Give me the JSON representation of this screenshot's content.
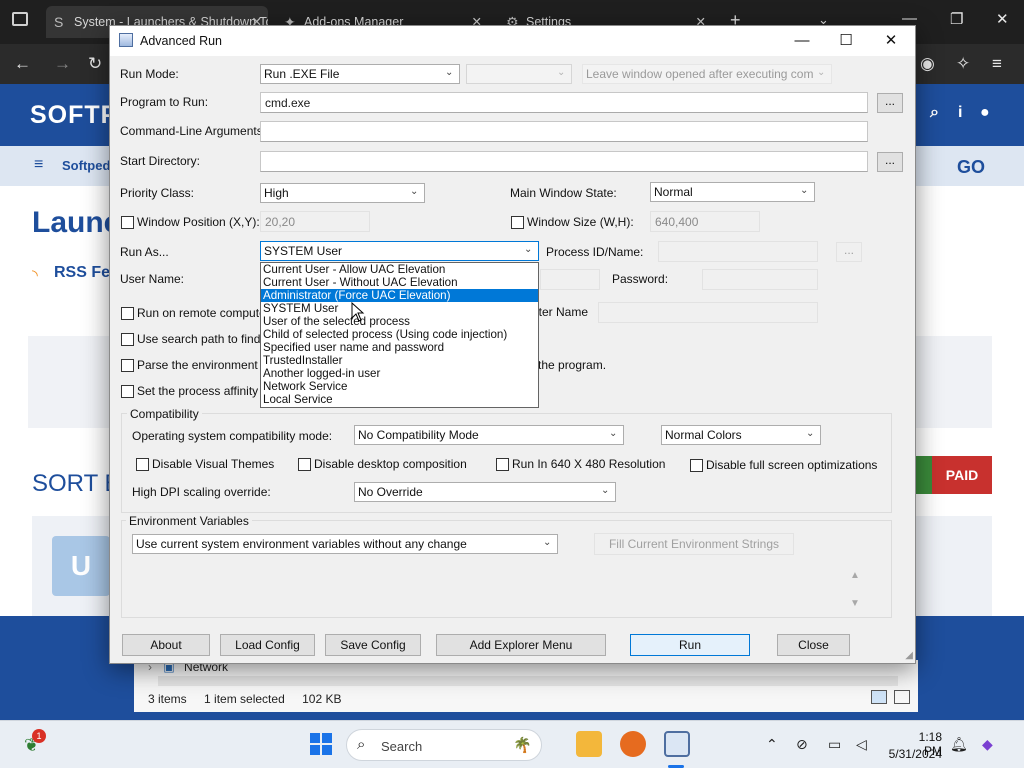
{
  "browser": {
    "tabs": [
      {
        "title": "System - Launchers & Shutdown Tools"
      },
      {
        "title": "Add-ons Manager"
      },
      {
        "title": "Settings"
      }
    ]
  },
  "website": {
    "logo": "SOFTP",
    "nav_label": "Softpedia",
    "go_label": "GO",
    "heading": "Launch",
    "rss_label": "RSS Feed",
    "sort_label": "SORT BY",
    "paid_label": "PAID",
    "thumb_letter": "U"
  },
  "explorer": {
    "network_label": "Network",
    "status": {
      "items": "3 items",
      "selected": "1 item selected",
      "size": "102 KB"
    }
  },
  "taskbar": {
    "notification_count": "1",
    "search_placeholder": "Search",
    "clock_time": "1:18 PM",
    "clock_date": "5/31/2024"
  },
  "dialog": {
    "title": "Advanced Run",
    "run_mode": {
      "label": "Run Mode:",
      "value": "Run .EXE File",
      "leave_open": "Leave window opened after executing command"
    },
    "program": {
      "label": "Program to Run:",
      "value": "cmd.exe",
      "browse": "..."
    },
    "cmdline": {
      "label": "Command-Line Arguments:",
      "value": ""
    },
    "startdir": {
      "label": "Start Directory:",
      "value": "",
      "browse": "..."
    },
    "priority": {
      "label": "Priority Class:",
      "value": "High"
    },
    "window_state": {
      "label": "Main Window State:",
      "value": "Normal"
    },
    "window_pos": {
      "label": "Window Position (X,Y):",
      "value": "20,20"
    },
    "window_size": {
      "label": "Window Size (W,H):",
      "value": "640,400"
    },
    "run_as": {
      "label": "Run As...",
      "value": "SYSTEM User",
      "options": [
        "Current User - Allow UAC Elevation",
        "Current User - Without UAC Elevation",
        "Administrator (Force UAC Elevation)",
        "SYSTEM User",
        "User of the selected process",
        "Child of selected process (Using code injection)",
        "Specified user name and password",
        "TrustedInstaller",
        "Another logged-in user",
        "Network Service",
        "Local Service"
      ],
      "highlighted_index": 2
    },
    "process_id": {
      "label": "Process ID/Name:",
      "browse": "..."
    },
    "username": {
      "label": "User Name:"
    },
    "password": {
      "label": "Password:"
    },
    "remote": {
      "label": "Run on remote computer",
      "computer_label": "Computer Name:"
    },
    "search_path": {
      "label": "Use search path to find the program location"
    },
    "parse_env": {
      "label": "Parse the environment variables",
      "suffix": "the program."
    },
    "affinity": {
      "label": "Set the process affinity mask"
    },
    "compat": {
      "group_label": "Compatibility",
      "mode_label": "Operating system compatibility mode:",
      "mode_value": "No Compatibility Mode",
      "colors_value": "Normal Colors",
      "visual_themes": "Disable Visual Themes",
      "desktop_comp": "Disable desktop composition",
      "res_640": "Run In 640 X 480 Resolution",
      "fullscreen": "Disable full screen optimizations",
      "dpi_label": "High DPI scaling override:",
      "dpi_value": "No Override"
    },
    "env": {
      "group_label": "Environment Variables",
      "mode_value": "Use current system environment variables without any change",
      "fill_button": "Fill Current Environment Strings"
    },
    "buttons": {
      "about": "About",
      "load": "Load Config",
      "save": "Save Config",
      "explorer_menu": "Add Explorer Menu",
      "run": "Run",
      "close": "Close"
    }
  }
}
